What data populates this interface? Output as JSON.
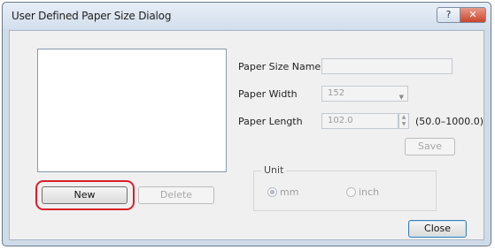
{
  "window": {
    "title": "User Defined Paper Size Dialog",
    "help_button": "?",
    "close_button": "✕"
  },
  "left": {
    "new_button": "New",
    "delete_button": "Delete"
  },
  "form": {
    "paper_size_name_label": "Paper Size Name",
    "paper_size_name_value": "",
    "paper_width_label": "Paper Width",
    "paper_width_value": "152",
    "paper_length_label": "Paper Length",
    "paper_length_value": "102.0",
    "range_hint": "(50.0–1000.0)",
    "save_button": "Save"
  },
  "unit": {
    "title": "Unit",
    "mm_label": "mm",
    "inch_label": "inch",
    "selected": "mm"
  },
  "footer": {
    "close_button": "Close"
  },
  "colors": {
    "highlight": "#d9202a",
    "window_frame": "#cfdbe8"
  }
}
